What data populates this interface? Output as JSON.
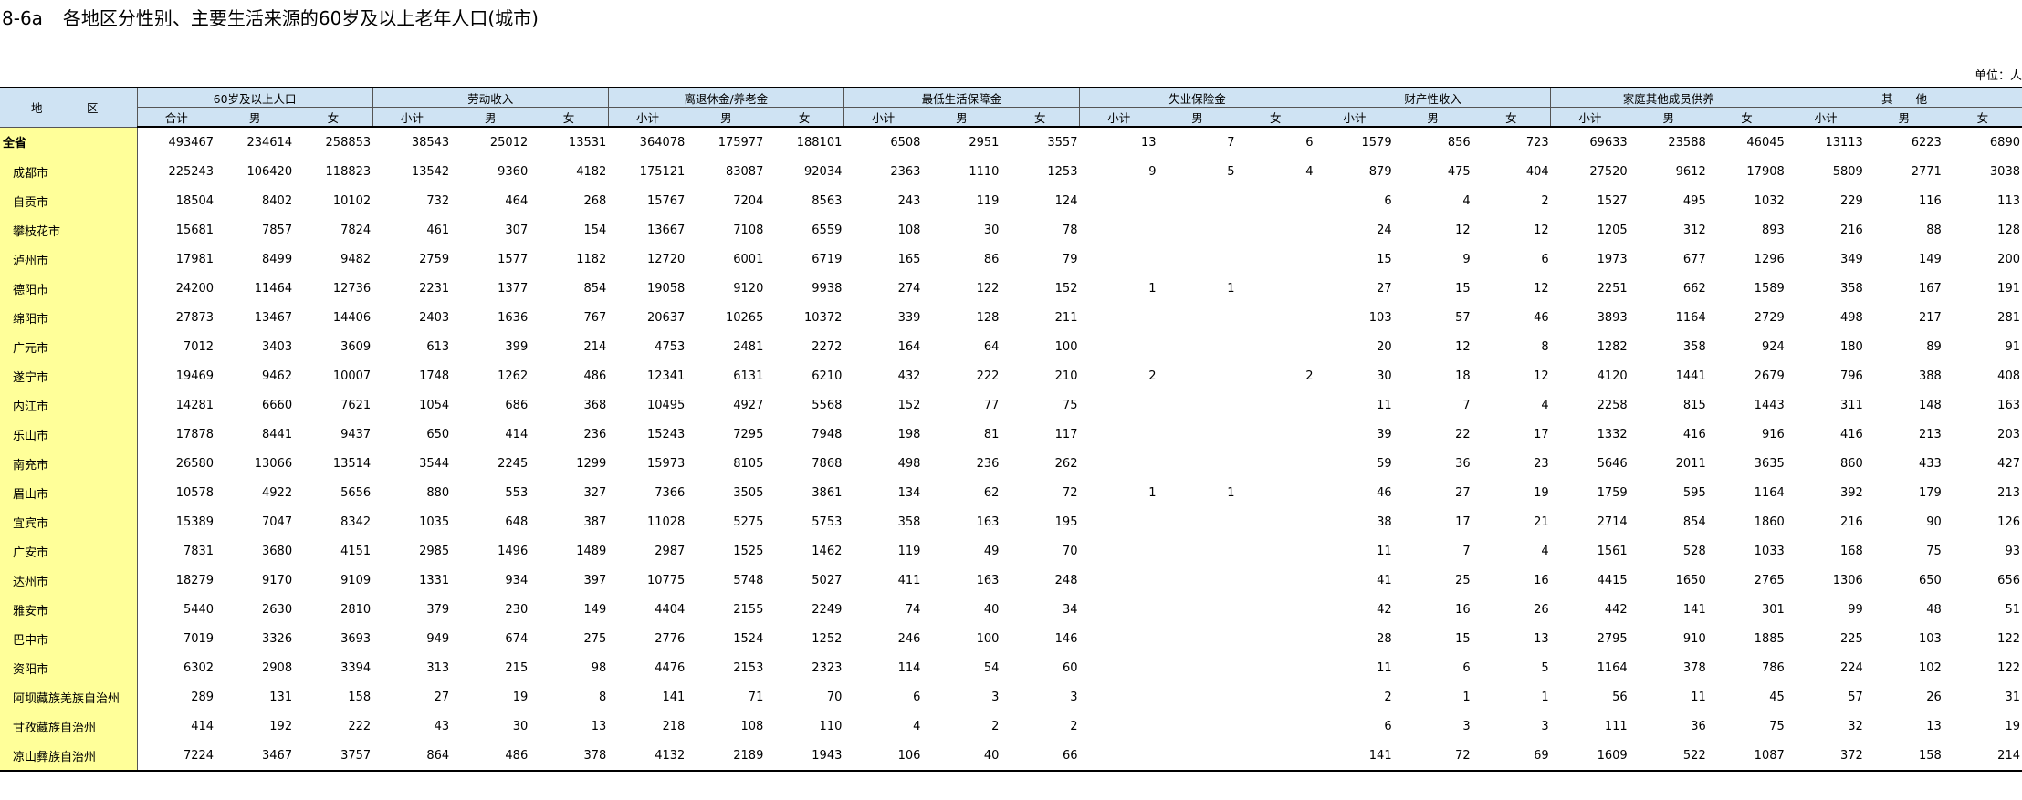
{
  "title": {
    "code": "8-6a",
    "text": "各地区分性别、主要生活来源的60岁及以上老年人口(城市)"
  },
  "unit": "单位：人",
  "header": {
    "region": "地　区",
    "groups": [
      "60岁及以上人口",
      "劳动收入",
      "离退休金/养老金",
      "最低生活保障金",
      "失业保险金",
      "财产性收入",
      "家庭其他成员供养",
      "其　　他"
    ],
    "subcols": [
      [
        "合计",
        "男",
        "女"
      ],
      [
        "小计",
        "男",
        "女"
      ],
      [
        "小计",
        "男",
        "女"
      ],
      [
        "小计",
        "男",
        "女"
      ],
      [
        "小计",
        "男",
        "女"
      ],
      [
        "小计",
        "男",
        "女"
      ],
      [
        "小计",
        "男",
        "女"
      ],
      [
        "小计",
        "男",
        "女"
      ]
    ]
  },
  "rows": [
    {
      "region": "全省",
      "cells": [
        "493467",
        "234614",
        "258853",
        "38543",
        "25012",
        "13531",
        "364078",
        "175977",
        "188101",
        "6508",
        "2951",
        "3557",
        "13",
        "7",
        "6",
        "1579",
        "856",
        "723",
        "69633",
        "23588",
        "46045",
        "13113",
        "6223",
        "6890"
      ]
    },
    {
      "region": "成都市",
      "cells": [
        "225243",
        "106420",
        "118823",
        "13542",
        "9360",
        "4182",
        "175121",
        "83087",
        "92034",
        "2363",
        "1110",
        "1253",
        "9",
        "5",
        "4",
        "879",
        "475",
        "404",
        "27520",
        "9612",
        "17908",
        "5809",
        "2771",
        "3038"
      ]
    },
    {
      "region": "自贡市",
      "cells": [
        "18504",
        "8402",
        "10102",
        "732",
        "464",
        "268",
        "15767",
        "7204",
        "8563",
        "243",
        "119",
        "124",
        "",
        "",
        "",
        "6",
        "4",
        "2",
        "1527",
        "495",
        "1032",
        "229",
        "116",
        "113"
      ]
    },
    {
      "region": "攀枝花市",
      "cells": [
        "15681",
        "7857",
        "7824",
        "461",
        "307",
        "154",
        "13667",
        "7108",
        "6559",
        "108",
        "30",
        "78",
        "",
        "",
        "",
        "24",
        "12",
        "12",
        "1205",
        "312",
        "893",
        "216",
        "88",
        "128"
      ]
    },
    {
      "region": "泸州市",
      "cells": [
        "17981",
        "8499",
        "9482",
        "2759",
        "1577",
        "1182",
        "12720",
        "6001",
        "6719",
        "165",
        "86",
        "79",
        "",
        "",
        "",
        "15",
        "9",
        "6",
        "1973",
        "677",
        "1296",
        "349",
        "149",
        "200"
      ]
    },
    {
      "region": "德阳市",
      "cells": [
        "24200",
        "11464",
        "12736",
        "2231",
        "1377",
        "854",
        "19058",
        "9120",
        "9938",
        "274",
        "122",
        "152",
        "1",
        "1",
        "",
        "27",
        "15",
        "12",
        "2251",
        "662",
        "1589",
        "358",
        "167",
        "191"
      ]
    },
    {
      "region": "绵阳市",
      "cells": [
        "27873",
        "13467",
        "14406",
        "2403",
        "1636",
        "767",
        "20637",
        "10265",
        "10372",
        "339",
        "128",
        "211",
        "",
        "",
        "",
        "103",
        "57",
        "46",
        "3893",
        "1164",
        "2729",
        "498",
        "217",
        "281"
      ]
    },
    {
      "region": "广元市",
      "cells": [
        "7012",
        "3403",
        "3609",
        "613",
        "399",
        "214",
        "4753",
        "2481",
        "2272",
        "164",
        "64",
        "100",
        "",
        "",
        "",
        "20",
        "12",
        "8",
        "1282",
        "358",
        "924",
        "180",
        "89",
        "91"
      ]
    },
    {
      "region": "遂宁市",
      "cells": [
        "19469",
        "9462",
        "10007",
        "1748",
        "1262",
        "486",
        "12341",
        "6131",
        "6210",
        "432",
        "222",
        "210",
        "2",
        "",
        "2",
        "30",
        "18",
        "12",
        "4120",
        "1441",
        "2679",
        "796",
        "388",
        "408"
      ]
    },
    {
      "region": "内江市",
      "cells": [
        "14281",
        "6660",
        "7621",
        "1054",
        "686",
        "368",
        "10495",
        "4927",
        "5568",
        "152",
        "77",
        "75",
        "",
        "",
        "",
        "11",
        "7",
        "4",
        "2258",
        "815",
        "1443",
        "311",
        "148",
        "163"
      ]
    },
    {
      "region": "乐山市",
      "cells": [
        "17878",
        "8441",
        "9437",
        "650",
        "414",
        "236",
        "15243",
        "7295",
        "7948",
        "198",
        "81",
        "117",
        "",
        "",
        "",
        "39",
        "22",
        "17",
        "1332",
        "416",
        "916",
        "416",
        "213",
        "203"
      ]
    },
    {
      "region": "南充市",
      "cells": [
        "26580",
        "13066",
        "13514",
        "3544",
        "2245",
        "1299",
        "15973",
        "8105",
        "7868",
        "498",
        "236",
        "262",
        "",
        "",
        "",
        "59",
        "36",
        "23",
        "5646",
        "2011",
        "3635",
        "860",
        "433",
        "427"
      ]
    },
    {
      "region": "眉山市",
      "cells": [
        "10578",
        "4922",
        "5656",
        "880",
        "553",
        "327",
        "7366",
        "3505",
        "3861",
        "134",
        "62",
        "72",
        "1",
        "1",
        "",
        "46",
        "27",
        "19",
        "1759",
        "595",
        "1164",
        "392",
        "179",
        "213"
      ]
    },
    {
      "region": "宜宾市",
      "cells": [
        "15389",
        "7047",
        "8342",
        "1035",
        "648",
        "387",
        "11028",
        "5275",
        "5753",
        "358",
        "163",
        "195",
        "",
        "",
        "",
        "38",
        "17",
        "21",
        "2714",
        "854",
        "1860",
        "216",
        "90",
        "126"
      ]
    },
    {
      "region": "广安市",
      "cells": [
        "7831",
        "3680",
        "4151",
        "2985",
        "1496",
        "1489",
        "2987",
        "1525",
        "1462",
        "119",
        "49",
        "70",
        "",
        "",
        "",
        "11",
        "7",
        "4",
        "1561",
        "528",
        "1033",
        "168",
        "75",
        "93"
      ]
    },
    {
      "region": "达州市",
      "cells": [
        "18279",
        "9170",
        "9109",
        "1331",
        "934",
        "397",
        "10775",
        "5748",
        "5027",
        "411",
        "163",
        "248",
        "",
        "",
        "",
        "41",
        "25",
        "16",
        "4415",
        "1650",
        "2765",
        "1306",
        "650",
        "656"
      ]
    },
    {
      "region": "雅安市",
      "cells": [
        "5440",
        "2630",
        "2810",
        "379",
        "230",
        "149",
        "4404",
        "2155",
        "2249",
        "74",
        "40",
        "34",
        "",
        "",
        "",
        "42",
        "16",
        "26",
        "442",
        "141",
        "301",
        "99",
        "48",
        "51"
      ]
    },
    {
      "region": "巴中市",
      "cells": [
        "7019",
        "3326",
        "3693",
        "949",
        "674",
        "275",
        "2776",
        "1524",
        "1252",
        "246",
        "100",
        "146",
        "",
        "",
        "",
        "28",
        "15",
        "13",
        "2795",
        "910",
        "1885",
        "225",
        "103",
        "122"
      ]
    },
    {
      "region": "资阳市",
      "cells": [
        "6302",
        "2908",
        "3394",
        "313",
        "215",
        "98",
        "4476",
        "2153",
        "2323",
        "114",
        "54",
        "60",
        "",
        "",
        "",
        "11",
        "6",
        "5",
        "1164",
        "378",
        "786",
        "224",
        "102",
        "122"
      ]
    },
    {
      "region": "阿坝藏族羌族自治州",
      "cells": [
        "289",
        "131",
        "158",
        "27",
        "19",
        "8",
        "141",
        "71",
        "70",
        "6",
        "3",
        "3",
        "",
        "",
        "",
        "2",
        "1",
        "1",
        "56",
        "11",
        "45",
        "57",
        "26",
        "31"
      ]
    },
    {
      "region": "甘孜藏族自治州",
      "cells": [
        "414",
        "192",
        "222",
        "43",
        "30",
        "13",
        "218",
        "108",
        "110",
        "4",
        "2",
        "2",
        "",
        "",
        "",
        "6",
        "3",
        "3",
        "111",
        "36",
        "75",
        "32",
        "13",
        "19"
      ]
    },
    {
      "region": "凉山彝族自治州",
      "cells": [
        "7224",
        "3467",
        "3757",
        "864",
        "486",
        "378",
        "4132",
        "2189",
        "1943",
        "106",
        "40",
        "66",
        "",
        "",
        "",
        "141",
        "72",
        "69",
        "1609",
        "522",
        "1087",
        "372",
        "158",
        "214"
      ]
    }
  ]
}
